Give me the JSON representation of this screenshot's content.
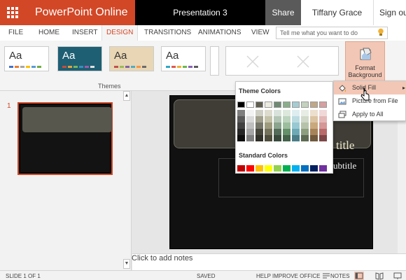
{
  "app": {
    "name": "PowerPoint Online",
    "doc_title": "Presentation 3",
    "share": "Share",
    "user": "Tiffany Grace Reyes",
    "sign_out": "Sign out"
  },
  "tabs": [
    {
      "label": "FILE"
    },
    {
      "label": "HOME"
    },
    {
      "label": "INSERT"
    },
    {
      "label": "DESIGN"
    },
    {
      "label": "TRANSITIONS"
    },
    {
      "label": "ANIMATIONS"
    },
    {
      "label": "VIEW"
    }
  ],
  "active_tab": "DESIGN",
  "tell_me": {
    "placeholder": "Tell me what you want to do"
  },
  "ribbon": {
    "themes_label": "Themes",
    "themes": [
      {
        "label": "Aa",
        "bg": "#ffffff",
        "fg": "#333333",
        "swatches": [
          "#4472c4",
          "#ed7d31",
          "#a5a5a5",
          "#ffc000",
          "#5b9bd5",
          "#70ad47"
        ]
      },
      {
        "label": "Aa",
        "bg": "#1e5f73",
        "fg": "#ffffff",
        "swatches": [
          "#c84b3a",
          "#e2a33d",
          "#7ab55c",
          "#3c8dbc",
          "#a15ba8",
          "#e0e0e0"
        ]
      },
      {
        "label": "Aa",
        "bg": "#e8d6b4",
        "fg": "#333333",
        "swatches": [
          "#c0504d",
          "#9bbb59",
          "#8064a2",
          "#4bacc6",
          "#f79646",
          "#6b6b6b"
        ]
      },
      {
        "label": "Aa",
        "bg": "#ffffff",
        "fg": "#333333",
        "swatches": [
          "#2ea8c6",
          "#e05a4e",
          "#f2b134",
          "#6bb84a",
          "#8a63b5",
          "#5c5c5c"
        ]
      }
    ],
    "format_background": "Format Background",
    "format_background_arrow": "▾"
  },
  "theme_colors_label": "Theme Colors",
  "standard_colors_label": "Standard Colors",
  "theme_colors": [
    [
      "#000000",
      "#ffffff",
      "#5f5e50",
      "#ecebe0",
      "#6f8a73",
      "#8aae8c",
      "#a6ccd3",
      "#c4d1bd",
      "#bfa888",
      "#d6a0a0"
    ],
    [
      "#7f7f7f",
      "#f2f2f2",
      "#cfcec4",
      "#dcdbcd",
      "#d9e2da",
      "#dde8dd",
      "#ddedf0",
      "#e7ece4",
      "#ecdfce",
      "#f0d8d8"
    ],
    [
      "#595959",
      "#d9d9d9",
      "#a09f8d",
      "#c3c1a7",
      "#b3c5b5",
      "#bcd3bd",
      "#bcdbe1",
      "#cfd8c9",
      "#dbc4a3",
      "#e3b7b7"
    ],
    [
      "#404040",
      "#bfbfbf",
      "#77766a",
      "#9d9b7d",
      "#8aa48e",
      "#9cbe9e",
      "#98c9d2",
      "#b6c3aa",
      "#c8a87d",
      "#d49696"
    ],
    [
      "#262626",
      "#a6a6a6",
      "#48473c",
      "#74725a",
      "#566c5a",
      "#64906a",
      "#6eaab6",
      "#8e9f80",
      "#a7835a",
      "#b96a6a"
    ],
    [
      "#0d0d0d",
      "#7f7f7f",
      "#302f28",
      "#4f4d3c",
      "#394a3c",
      "#44634a",
      "#4b7e88",
      "#5e6b53",
      "#71593d",
      "#7e4646"
    ]
  ],
  "standard_colors": [
    "#c00000",
    "#ff0000",
    "#ffc000",
    "#ffff00",
    "#92d050",
    "#00b050",
    "#00b0f0",
    "#0070c0",
    "#002060",
    "#7030a0"
  ],
  "menu": [
    {
      "label": "Solid Fill",
      "icon": "paint-bucket-icon",
      "has_submenu": true
    },
    {
      "label": "Picture from File",
      "icon": "picture-icon"
    },
    {
      "label": "Apply to All",
      "icon": "apply-all-icon"
    }
  ],
  "thumbnail": {
    "number": "1"
  },
  "slide": {
    "title": "title",
    "subtitle": "ubtitle"
  },
  "notes_placeholder": "Click to add notes",
  "status": {
    "slide": "SLIDE 1 OF 1",
    "saved": "SAVED",
    "help": "HELP IMPROVE OFFICE",
    "notes": "NOTES"
  },
  "colors": {
    "accent": "#d24726",
    "hover": "#f3c7b5"
  }
}
